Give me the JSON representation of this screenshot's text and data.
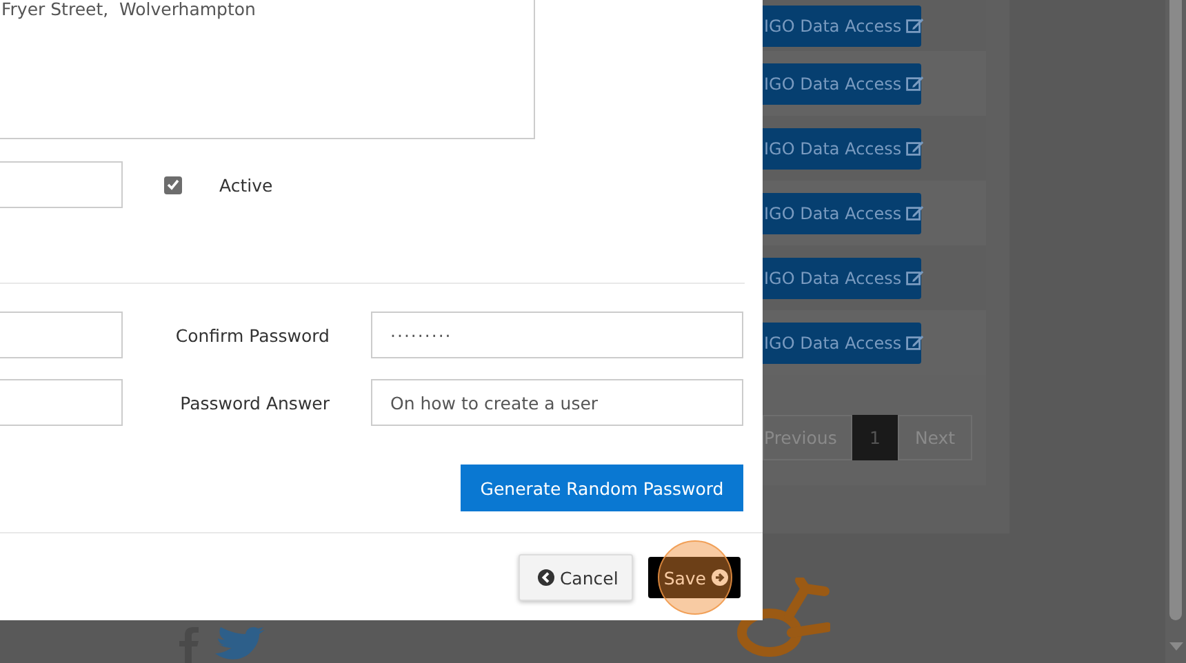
{
  "modal": {
    "address": {
      "value": "Fryer Street,  Wolverhampton"
    },
    "active": {
      "label": "Active",
      "checked": true
    },
    "password_rows": [
      {
        "label": "Confirm Password",
        "value": "·········",
        "kind": "password"
      },
      {
        "label": "Password Answer",
        "value": "On how to create a user",
        "kind": "text"
      }
    ],
    "generate_button": "Generate Random Password",
    "footer_buttons": [
      {
        "label": "Cancel",
        "kind": "cancel",
        "highlighted": false
      },
      {
        "label": "Save",
        "kind": "save",
        "highlighted": true
      }
    ]
  },
  "background": {
    "rows": [
      {
        "button": "IGO Data Access"
      },
      {
        "button": "IGO Data Access"
      },
      {
        "button": "IGO Data Access"
      },
      {
        "button": "IGO Data Access"
      },
      {
        "button": "IGO Data Access"
      },
      {
        "button": "IGO Data Access"
      }
    ],
    "pagination": [
      {
        "label": "Previous",
        "selected": false
      },
      {
        "label": "1",
        "selected": true
      },
      {
        "label": "Next",
        "selected": false
      }
    ]
  }
}
